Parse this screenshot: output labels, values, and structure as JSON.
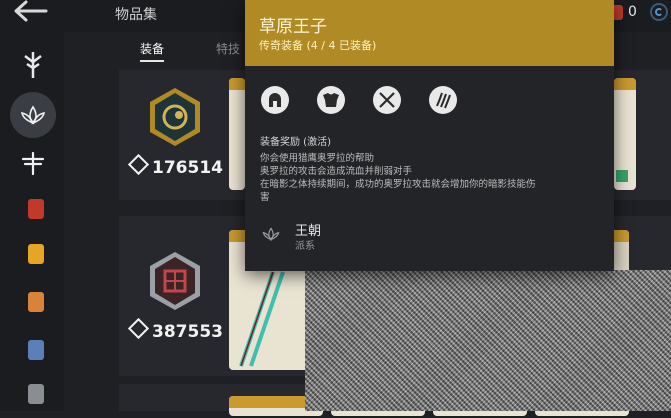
{
  "header": {
    "title": "物品集",
    "currency_value": "0"
  },
  "tabs": [
    {
      "label": "装备"
    },
    {
      "label": "特技"
    }
  ],
  "rows": [
    {
      "score": "176514"
    },
    {
      "score": "387553"
    }
  ],
  "tooltip": {
    "title": "草原王子",
    "subtitle": "传奇装备 (4 / 4 已装备)",
    "bonus_title": "装备奖励 (激活)",
    "bonus_lines": [
      "你会使用猎鹰奥罗拉的帮助",
      "奥罗拉的攻击会造成流血并削弱对手",
      "在暗影之体持续期间，成功的奥罗拉攻击就会增加你的暗影技能伤",
      "害"
    ],
    "dynasty_name": "王朝",
    "dynasty_sub": "派系"
  },
  "colors": {
    "accent_gold": "#b08a25",
    "background": "#1f2024",
    "card_red": "#c0392b",
    "card_yellow": "#e5a623",
    "card_orange": "#d9833a",
    "card_blue": "#5b7fb8",
    "card_gray": "#8a8d94"
  },
  "icons": {
    "back": "arrow-left-icon",
    "sidebar": [
      "sword-emblem-icon",
      "lotus-icon",
      "dragonfly-icon",
      "red-cards-icon",
      "yellow-cards-icon",
      "orange-cards-icon",
      "blue-cards-icon",
      "gray-cards-icon"
    ],
    "tooltip_slots": [
      "helmet-icon",
      "armor-icon",
      "crossed-swords-icon",
      "claws-icon"
    ]
  }
}
